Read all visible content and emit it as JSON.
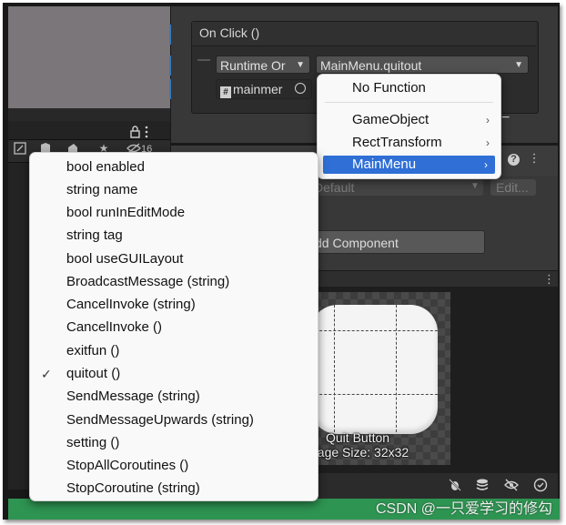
{
  "onclick": {
    "title": "On Click ()",
    "runtime_dropdown": "Runtime Or",
    "function_dropdown": "MainMenu.quitout",
    "object_field": "mainmer",
    "minus_button": "−"
  },
  "inspector": {
    "default_field": "Default",
    "edit_button": "Edit...",
    "add_component": "dd Component",
    "help_icon": "?",
    "more_icon": "⋮",
    "ruler_number": "16"
  },
  "object_menu": {
    "items": [
      {
        "label": "No Function"
      },
      {
        "label": "GameObject",
        "submenu": true
      },
      {
        "label": "RectTransform",
        "submenu": true
      },
      {
        "label": "MainMenu",
        "submenu": true,
        "selected": true
      }
    ]
  },
  "method_menu": {
    "items": [
      {
        "label": "bool enabled"
      },
      {
        "label": "string name"
      },
      {
        "label": "bool runInEditMode"
      },
      {
        "label": "string tag"
      },
      {
        "label": "bool useGUILayout"
      },
      {
        "label": "BroadcastMessage (string)"
      },
      {
        "label": "CancelInvoke (string)"
      },
      {
        "label": "CancelInvoke ()"
      },
      {
        "label": "exitfun ()"
      },
      {
        "label": "quitout ()",
        "checked": true
      },
      {
        "label": "SendMessage (string)"
      },
      {
        "label": "SendMessageUpwards (string)"
      },
      {
        "label": "setting ()"
      },
      {
        "label": "StopAllCoroutines ()"
      },
      {
        "label": "StopCoroutine (string)"
      }
    ],
    "check_glyph": "✓"
  },
  "preview": {
    "title": "Quit Button",
    "size": "nage Size: 32x32"
  },
  "watermark": "CSDN @一只爱学习的修勾",
  "colors": {
    "selection": "#2f6fd6",
    "status_green": "#2e9452",
    "accent_blue": "#3a79bb"
  }
}
